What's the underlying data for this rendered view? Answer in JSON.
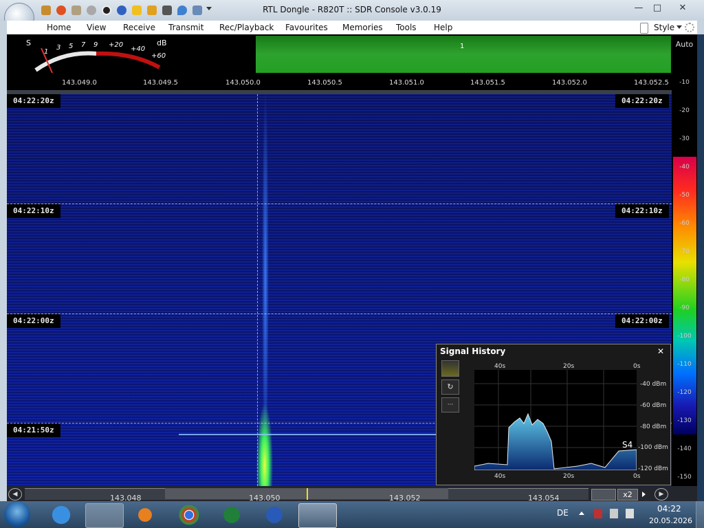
{
  "window": {
    "title": "RTL Dongle - R820T :: SDR Console v3.0.19",
    "minimize_glyph": "—",
    "maximize_glyph": "□",
    "close_glyph": "✕"
  },
  "menu": {
    "items": [
      "Home",
      "View",
      "Receive",
      "Transmit",
      "Rec/Playback",
      "Favourites",
      "Memories",
      "Tools",
      "Help"
    ],
    "style_label": "Style"
  },
  "smeter": {
    "s_label": "S",
    "db_label": "dB",
    "scale": [
      "1",
      "3",
      "5",
      "7",
      "9",
      "+20",
      "+40",
      "+60"
    ]
  },
  "spectrum": {
    "marker_label": "1",
    "frequency_ticks": [
      "143.049.0",
      "143.049.5",
      "143.050.0",
      "143.050.5",
      "143.051.0",
      "143.051.5",
      "143.052.0",
      "143.052.5"
    ]
  },
  "scale": {
    "auto_label": "Auto",
    "levels": [
      "-10",
      "-20",
      "-30",
      "-40",
      "-50",
      "-60",
      "-70",
      "-80",
      "-90",
      "-100",
      "-110",
      "-120",
      "-130",
      "-140",
      "-150"
    ]
  },
  "waterfall": {
    "timestamps": [
      "04:22:20z",
      "04:22:10z",
      "04:22:00z",
      "04:21:50z"
    ]
  },
  "bottom": {
    "frequencies": [
      "143.048",
      "143.050",
      "143.052",
      "143.054"
    ],
    "zoom_label": "x2"
  },
  "signal_history": {
    "title": "Signal History",
    "close_glyph": "✕",
    "time_labels": [
      "40s",
      "20s",
      "0s"
    ],
    "level_labels": [
      "-40 dBm",
      "-60 dBm",
      "-80 dBm",
      "-100 dBm",
      "-120 dBm"
    ],
    "s_value": "S4",
    "more_label": "···"
  },
  "taskbar": {
    "language": "DE",
    "time": "04:22",
    "date": "20.05.2026"
  }
}
